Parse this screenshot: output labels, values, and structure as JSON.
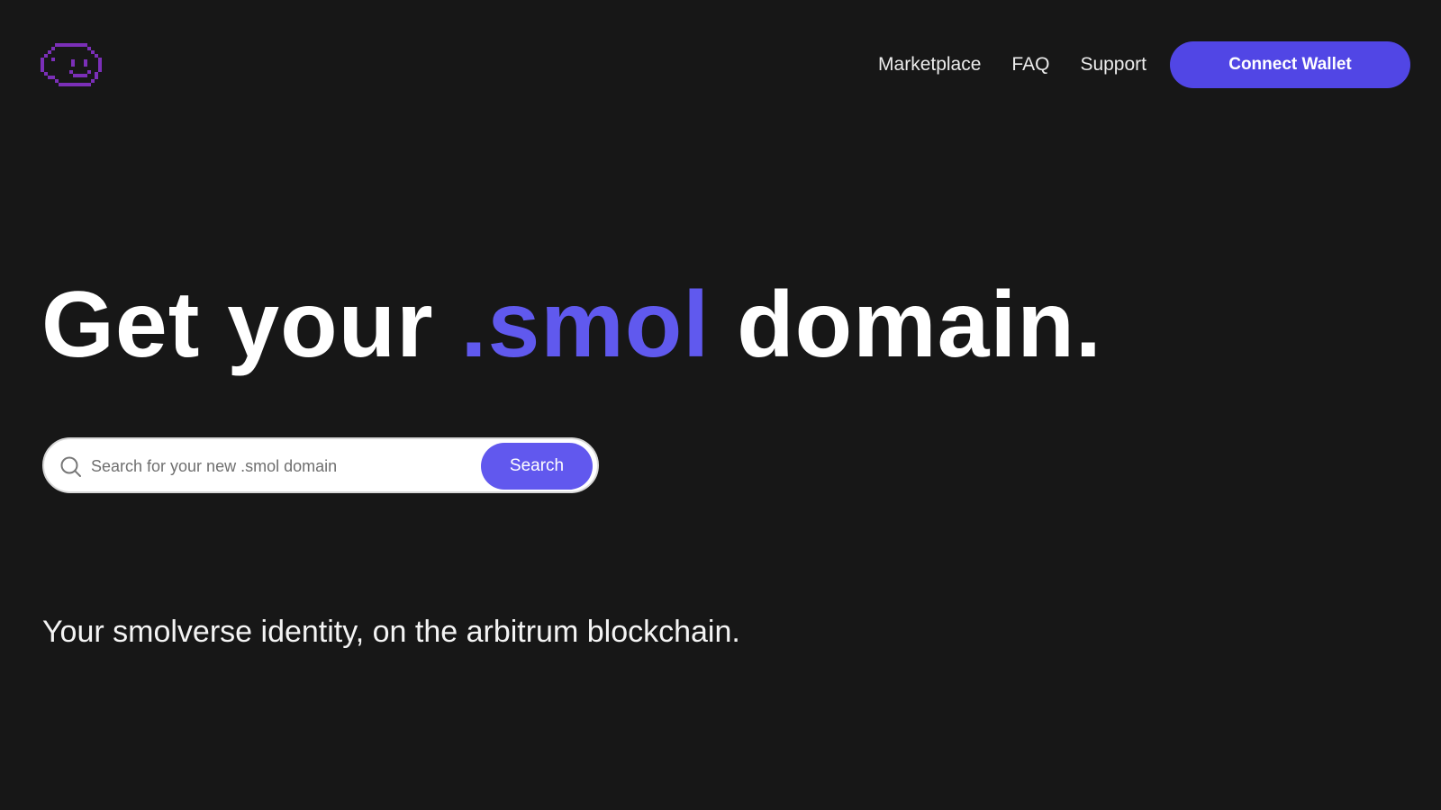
{
  "colors": {
    "background": "#171717",
    "accent": "#5146e5",
    "accent_text": "#6059ee",
    "logo_purple": "#7b2fb8"
  },
  "header": {
    "logo_icon": "smol-pixel-face-icon",
    "nav": {
      "marketplace": "Marketplace",
      "faq": "FAQ",
      "support": "Support"
    },
    "connect_wallet": "Connect Wallet"
  },
  "hero": {
    "title_before": "Get your",
    "title_accent": ".smol",
    "title_after": "domain."
  },
  "search": {
    "icon": "search-icon",
    "placeholder": "Search for your new .smol domain",
    "value": "",
    "button_label": "Search"
  },
  "tagline": "Your smolverse identity, on the arbitrum blockchain."
}
